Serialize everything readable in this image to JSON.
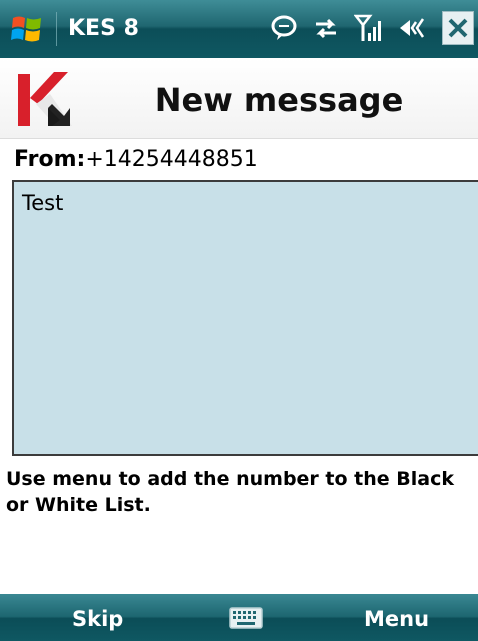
{
  "status_bar": {
    "app_title": "KES 8",
    "icons": [
      "windows-start-icon",
      "message-bubble-icon",
      "data-sync-icon",
      "signal-icon",
      "volume-icon",
      "close-icon"
    ]
  },
  "header": {
    "title": "New message",
    "logo": "kaspersky-logo"
  },
  "message": {
    "from_label": "From:",
    "from_value": "+14254448851",
    "body": "Test"
  },
  "hint": {
    "line1": "Use menu to add the number to the Black",
    "line2": "or White List."
  },
  "softkeys": {
    "left": "Skip",
    "center_icon": "keyboard-icon",
    "right": "Menu"
  },
  "colors": {
    "bar": "#1f6670",
    "message_bg": "#c8e0e8",
    "brand_red": "#d8202b"
  }
}
